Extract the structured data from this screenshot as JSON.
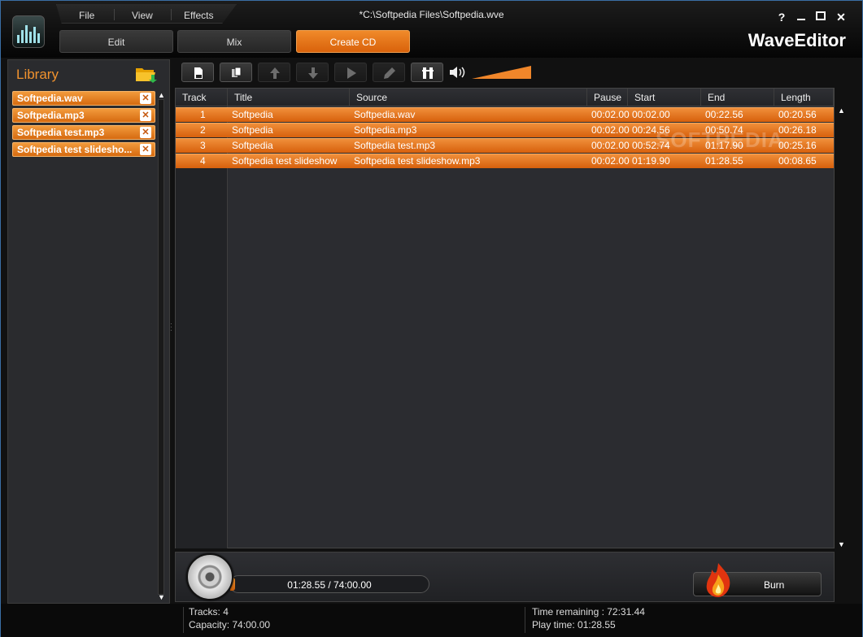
{
  "window": {
    "title": "*C:\\Softpedia Files\\Softpedia.wve",
    "brand": "WaveEditor",
    "help": "?",
    "close": "✕"
  },
  "menu": {
    "file": "File",
    "view": "View",
    "effects": "Effects"
  },
  "modes": {
    "edit": "Edit",
    "mix": "Mix",
    "create_cd": "Create CD",
    "active": "Create CD"
  },
  "library": {
    "title": "Library",
    "items": [
      {
        "label": "Softpedia.wav"
      },
      {
        "label": "Softpedia.mp3"
      },
      {
        "label": "Softpedia test.mp3"
      },
      {
        "label": "Softpedia test slidesho..."
      }
    ]
  },
  "toolbar": {
    "icons": [
      "new-track-icon",
      "copy-icon",
      "move-up-icon",
      "move-down-icon",
      "play-icon",
      "edit-icon",
      "settings-icon",
      "speaker-icon"
    ],
    "volume_level": 1.0,
    "accent": "#f0862a"
  },
  "table": {
    "columns": {
      "track": "Track",
      "title": "Title",
      "source": "Source",
      "pause": "Pause",
      "start": "Start",
      "end": "End",
      "length": "Length"
    },
    "rows": [
      {
        "track": "1",
        "title": "Softpedia",
        "source": "Softpedia.wav",
        "pause": "00:02.00",
        "start": "00:02.00",
        "end": "00:22.56",
        "length": "00:20.56"
      },
      {
        "track": "2",
        "title": "Softpedia",
        "source": "Softpedia.mp3",
        "pause": "00:02.00",
        "start": "00:24.56",
        "end": "00:50.74",
        "length": "00:26.18"
      },
      {
        "track": "3",
        "title": "Softpedia",
        "source": "Softpedia test.mp3",
        "pause": "00:02.00",
        "start": "00:52.74",
        "end": "01:17.90",
        "length": "00:25.16"
      },
      {
        "track": "4",
        "title": "Softpedia test slideshow",
        "source": "Softpedia test slideshow.mp3",
        "pause": "00:02.00",
        "start": "01:19.90",
        "end": "01:28.55",
        "length": "00:08.65"
      }
    ],
    "watermark": "SOFTPEDIA"
  },
  "cd": {
    "progress_text": "01:28.55 / 74:00.00",
    "progress_fraction": 0.02,
    "burn_label": "Burn"
  },
  "status": {
    "tracks": "Tracks: 4",
    "capacity": "Capacity: 74:00.00",
    "time_remaining": "Time remaining : 72:31.44",
    "play_time": "Play time: 01:28.55"
  }
}
